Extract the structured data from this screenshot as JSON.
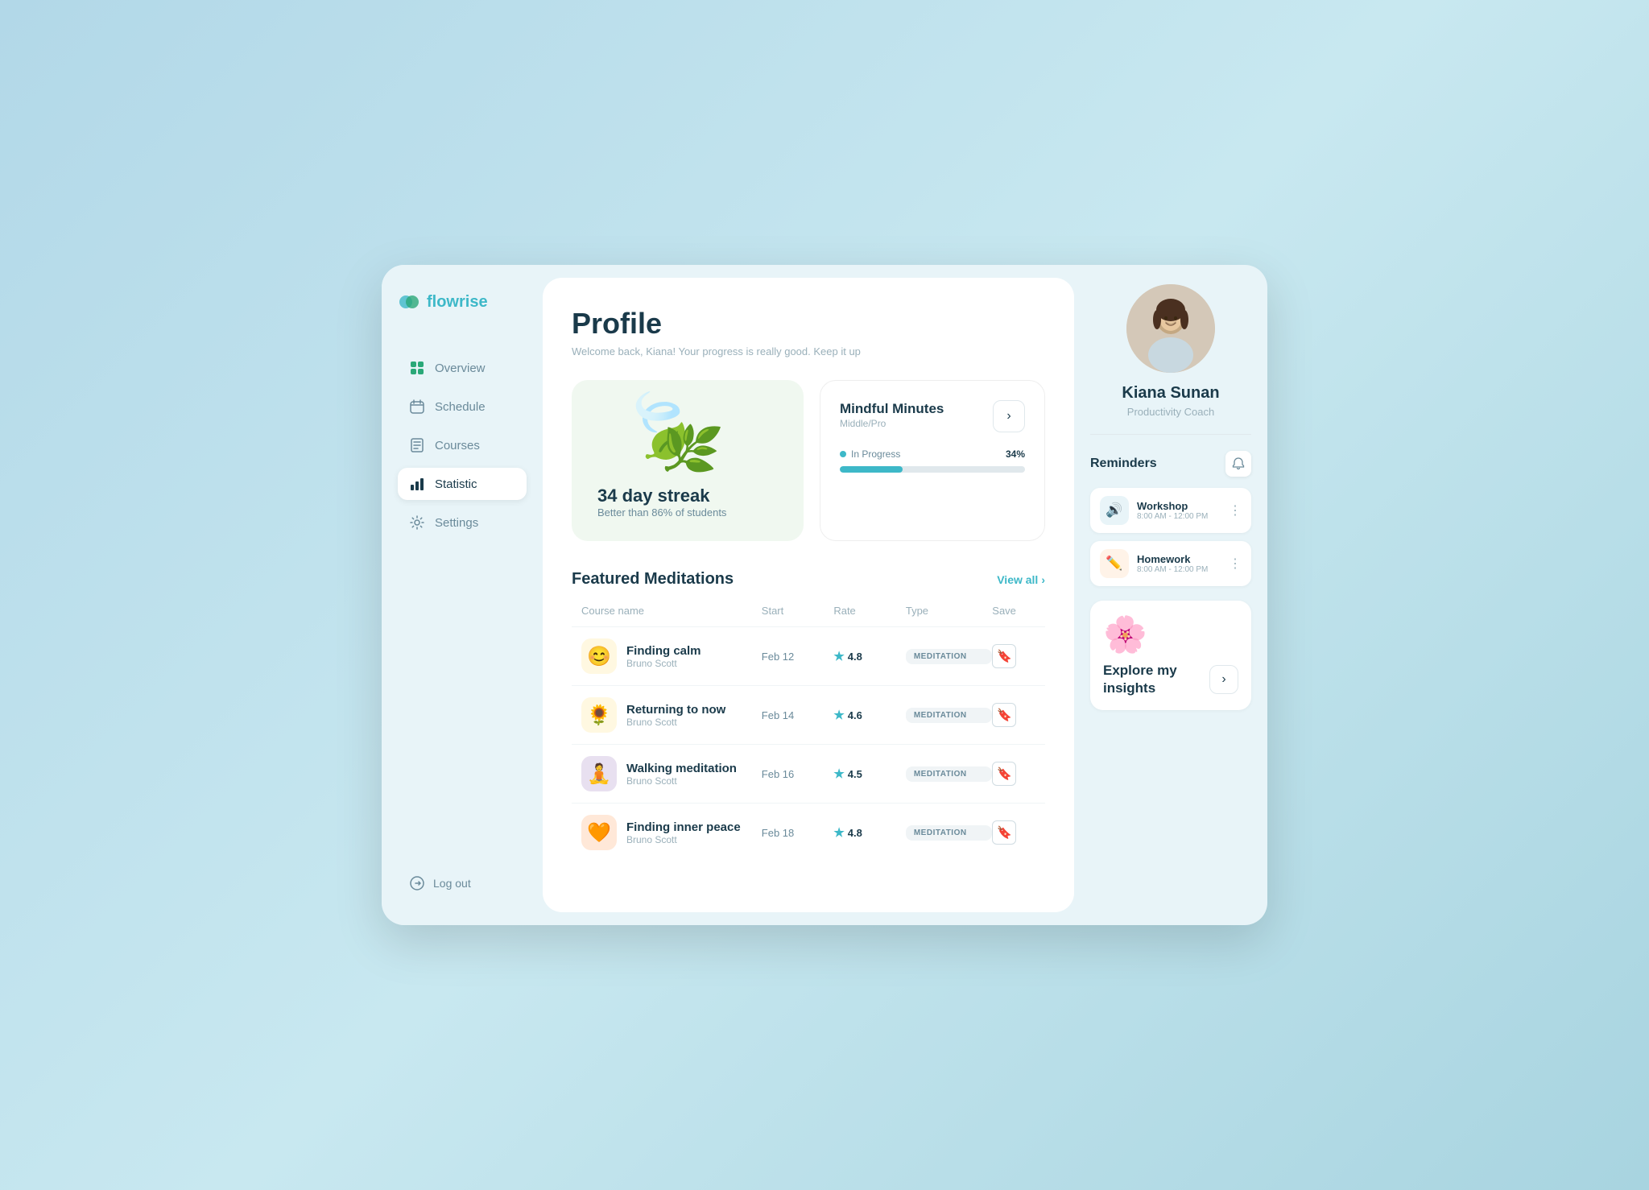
{
  "app": {
    "name": "flowrise",
    "name_highlight": "flow",
    "name_rest": "rise"
  },
  "sidebar": {
    "nav_items": [
      {
        "id": "overview",
        "label": "Overview",
        "icon": "grid"
      },
      {
        "id": "schedule",
        "label": "Schedule",
        "icon": "calendar"
      },
      {
        "id": "courses",
        "label": "Courses",
        "icon": "book"
      },
      {
        "id": "statistic",
        "label": "Statistic",
        "icon": "bar-chart"
      },
      {
        "id": "settings",
        "label": "Settings",
        "icon": "gear"
      }
    ],
    "logout_label": "Log out"
  },
  "profile": {
    "title": "Profile",
    "subtitle": "Welcome back, Kiana! Your progress is really good. Keep it up"
  },
  "streak_card": {
    "days": "34 day streak",
    "comparison": "Better than 86% of students"
  },
  "course_card": {
    "title": "Mindful Minutes",
    "level": "Middle/Pro",
    "progress_label": "In Progress",
    "progress_pct": 34,
    "progress_pct_text": "34%"
  },
  "featured_meditations": {
    "section_title": "Featured Meditations",
    "view_all": "View all",
    "columns": [
      "Course name",
      "Start",
      "Rate",
      "Type",
      "Save"
    ],
    "rows": [
      {
        "id": 1,
        "name": "Finding calm",
        "author": "Bruno Scott",
        "start": "Feb 12",
        "rate": "4.8",
        "type": "MEDITATION",
        "emoji": "😊",
        "bg": "#fff8e1"
      },
      {
        "id": 2,
        "name": "Returning to now",
        "author": "Bruno Scott",
        "start": "Feb 14",
        "rate": "4.6",
        "type": "MEDITATION",
        "emoji": "🌻",
        "bg": "#fff8e1"
      },
      {
        "id": 3,
        "name": "Walking meditation",
        "author": "Bruno Scott",
        "start": "Feb 16",
        "rate": "4.5",
        "type": "MEDITATION",
        "emoji": "🧘",
        "bg": "#e8e0f0"
      },
      {
        "id": 4,
        "name": "Finding inner peace",
        "author": "Bruno Scott",
        "start": "Feb 18",
        "rate": "4.8",
        "type": "MEDITATION",
        "emoji": "🧡",
        "bg": "#ffe8d8"
      }
    ]
  },
  "user": {
    "name": "Kiana Sunan",
    "role": "Productivity Coach"
  },
  "reminders": {
    "title": "Reminders",
    "items": [
      {
        "id": 1,
        "name": "Workshop",
        "time": "8:00 AM - 12:00 PM",
        "icon": "🔊",
        "icon_bg": "#e8f4f8"
      },
      {
        "id": 2,
        "name": "Homework",
        "time": "8:00 AM - 12:00 PM",
        "icon": "✏️",
        "icon_bg": "#fff3e8"
      }
    ]
  },
  "insights": {
    "title": "Explore my insights",
    "flower_emoji": "🌸"
  }
}
